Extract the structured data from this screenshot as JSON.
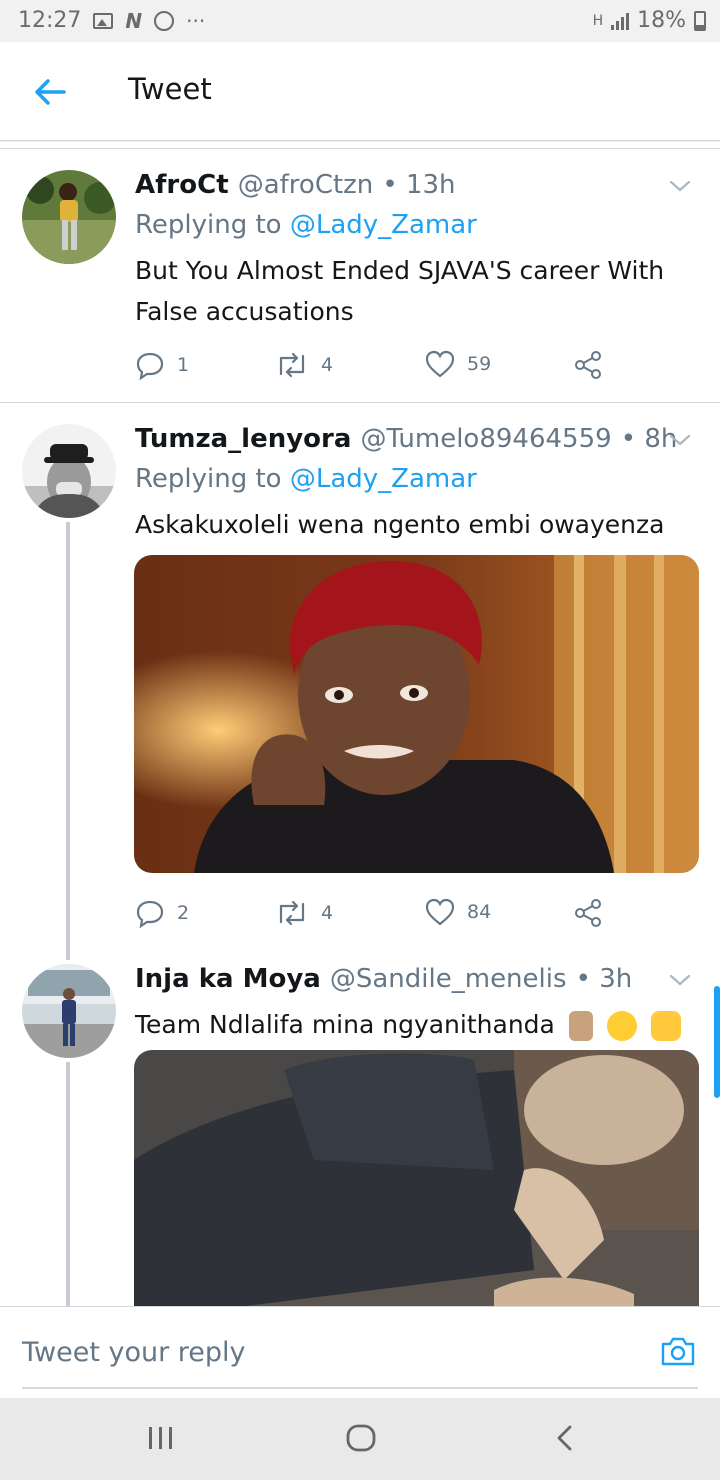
{
  "status_bar": {
    "time": "12:27",
    "icons": [
      "gallery-icon",
      "n-icon",
      "whatsapp-icon",
      "more-dots-icon"
    ],
    "more_dots": "···",
    "n_glyph": "N",
    "network": "H",
    "battery": "18%"
  },
  "header": {
    "title": "Tweet",
    "back_icon": "arrow-left-icon",
    "accent": "#1da1f2"
  },
  "tweets": [
    {
      "name": "AfroCt",
      "handle": "@afroCtzn",
      "time": "• 13h",
      "replying_label": "Replying to",
      "replying_handle": "@Lady_Zamar",
      "text": "But You Almost Ended SJAVA'S career With False accusations",
      "replies": "1",
      "retweets": "4",
      "likes": "59"
    },
    {
      "name": "Tumza_lenyora",
      "handle": "@Tumelo89464559",
      "time": "• 8h",
      "replying_label": "Replying to",
      "replying_handle": "@Lady_Zamar",
      "text": "Askakuxoleli wena ngento embi owayenza",
      "replies": "2",
      "retweets": "4",
      "likes": "84"
    },
    {
      "name": "Inja ka Moya",
      "handle": "@Sandile_menelis",
      "time": "• 3h",
      "text": "Team Ndlalifa mina ngyanithanda",
      "emojis": [
        "fingers-crossed-emoji",
        "rolling-eyes-emoji",
        "raised-hands-emoji"
      ]
    }
  ],
  "composer": {
    "placeholder": "Tweet your reply",
    "camera_icon": "camera-icon"
  },
  "nav_bar": {
    "icons": [
      "recents-icon",
      "home-icon",
      "back-icon"
    ]
  }
}
